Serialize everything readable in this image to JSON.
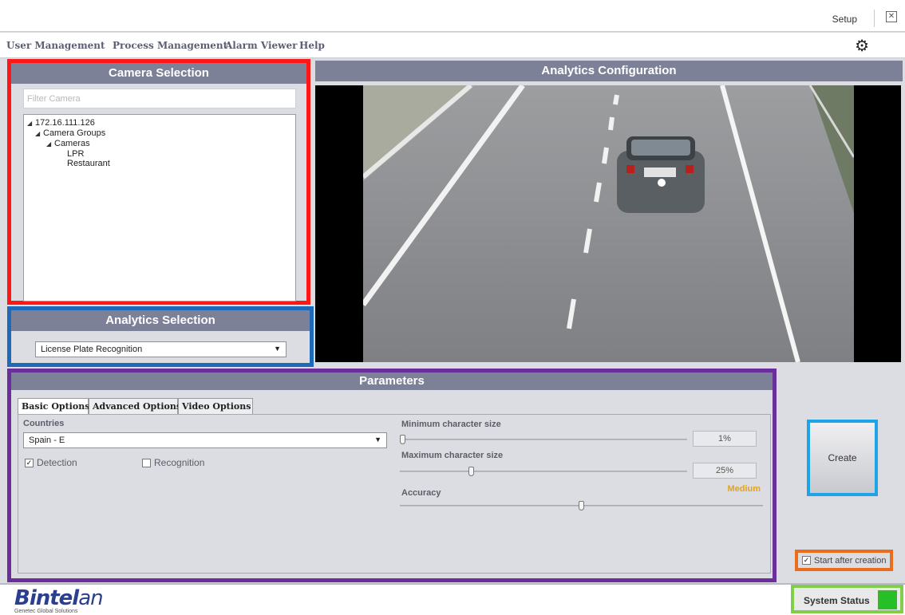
{
  "titlebar": {
    "setup_label": "Setup"
  },
  "menu": {
    "items": [
      {
        "label": "User Management"
      },
      {
        "label": "Process Management"
      },
      {
        "label": "Alarm Viewer"
      },
      {
        "label": "Help"
      }
    ]
  },
  "camera_selection": {
    "title": "Camera Selection",
    "filter_placeholder": "Filter Camera",
    "tree": {
      "host": "172.16.111.126",
      "group": "Camera Groups",
      "folder": "Cameras",
      "cameras": [
        "LPR",
        "Restaurant"
      ]
    }
  },
  "analytics_selection": {
    "title": "Analytics Selection",
    "selected": "License Plate Recognition"
  },
  "analytics_configuration": {
    "title": "Analytics Configuration"
  },
  "parameters": {
    "title": "Parameters",
    "tabs": [
      {
        "label": "Basic Options",
        "active": true
      },
      {
        "label": "Advanced Options",
        "active": false
      },
      {
        "label": "Video Options",
        "active": false
      }
    ],
    "countries_label": "Countries",
    "country_selected": "Spain - E",
    "detection_label": "Detection",
    "detection_checked": true,
    "recognition_label": "Recognition",
    "recognition_checked": false,
    "min_char_label": "Minimum character size",
    "min_char_value": "1%",
    "min_char_level": 0.01,
    "max_char_label": "Maximum character size",
    "max_char_value": "25%",
    "max_char_level": 0.25,
    "accuracy_label": "Accuracy",
    "accuracy_value": "Medium",
    "accuracy_level": 0.5
  },
  "create_label": "Create",
  "start_after_label": "Start after creation",
  "start_after_checked": true,
  "footer": {
    "logo_bold": "Bintel",
    "logo_light": "an",
    "logo_sub": "Genetec Global Solutions",
    "system_status_label": "System Status",
    "system_status_color": "#27bf27"
  }
}
